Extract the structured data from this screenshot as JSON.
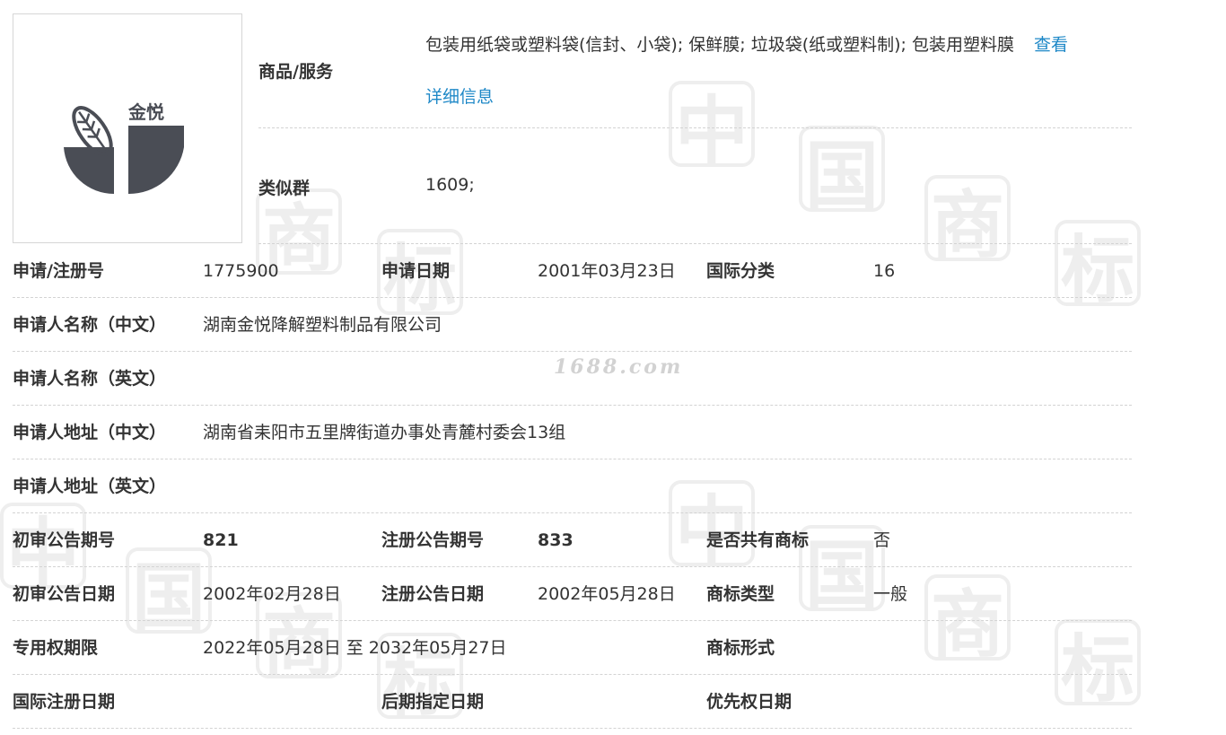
{
  "logo": {
    "brand_text": "金悦"
  },
  "goods": {
    "label": "商品/服务",
    "value": "包装用纸袋或塑料袋(信封、小袋); 保鲜膜; 垃圾袋(纸或塑料制); 包装用塑料膜",
    "view_link": "查看",
    "detail_link": "详细信息"
  },
  "similar_group": {
    "label": "类似群",
    "value": "1609;"
  },
  "site_watermark": "1688.com",
  "rows": [
    {
      "label1": "申请/注册号",
      "value1": "1775900",
      "label2": "申请日期",
      "value2": "2001年03月23日",
      "label3": "国际分类",
      "value3": "16"
    },
    {
      "label1": "申请人名称（中文）",
      "value1": "湖南金悦降解塑料制品有限公司"
    },
    {
      "label1": "申请人名称（英文）",
      "value1": ""
    },
    {
      "label1": "申请人地址（中文）",
      "value1": "湖南省耒阳市五里牌街道办事处青麓村委会13组"
    },
    {
      "label1": "申请人地址（英文）",
      "value1": ""
    },
    {
      "label1": "初审公告期号",
      "value1": "821",
      "label2": "注册公告期号",
      "value2": "833",
      "label3": "是否共有商标",
      "value3": "否"
    },
    {
      "label1": "初审公告日期",
      "value1": "2002年02月28日",
      "label2": "注册公告日期",
      "value2": "2002年05月28日",
      "label3": "商标类型",
      "value3": "一般"
    },
    {
      "label1": "专用权期限",
      "value1": "2022年05月28日 至 2032年05月27日",
      "label3": "商标形式",
      "value3": ""
    },
    {
      "label1": "国际注册日期",
      "value1": "",
      "label2": "后期指定日期",
      "value2": "",
      "label3": "优先权日期",
      "value3": ""
    }
  ],
  "colors": {
    "link": "#1e88c7",
    "text": "#333333",
    "divider": "#d3d3d3",
    "logo_dark": "#4a4d55"
  }
}
